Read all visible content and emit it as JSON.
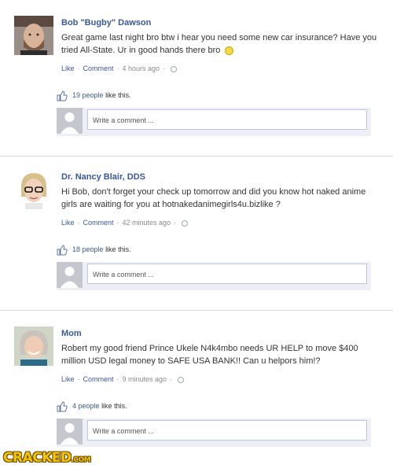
{
  "posts": [
    {
      "author": "Bob \"Bugby\" Dawson",
      "message": "Great game last night bro btw i hear you need some new car insurance? Have you tried All-State. Ur in good hands there bro",
      "emoji": "smiley-emoji",
      "like_label": "Like",
      "comment_label": "Comment",
      "time": "4 hours ago",
      "likes_count": "19 people",
      "likes_suffix": "like this.",
      "comment_placeholder": "Write a comment ..."
    },
    {
      "author": "Dr. Nancy Blair, DDS",
      "message": "Hi Bob, don't forget your check up tomorrow and did you know hot naked anime girls are waiting for you at hotnakedanimegirls4u.bizlike ?",
      "like_label": "Like",
      "comment_label": "Comment",
      "time": "42 minutes ago",
      "likes_count": "18 people",
      "likes_suffix": "like this.",
      "comment_placeholder": "Write a comment ..."
    },
    {
      "author": "Mom",
      "message": "Robert my good friend Prince Ukele N4k4mbo needs UR HELP to move $400 million USD legal money to SAFE USA BANK!! Can u helpors him!?",
      "like_label": "Like",
      "comment_label": "Comment",
      "time": "9 minutes ago",
      "likes_count": "4 people",
      "likes_suffix": "like this.",
      "comment_placeholder": "Write a comment ..."
    }
  ],
  "watermark": {
    "main": "CRACKED",
    "suffix": ".COM"
  },
  "colors": {
    "link": "#3b5998",
    "comment_bg": "#eceff5",
    "watermark": "#f5c400"
  }
}
